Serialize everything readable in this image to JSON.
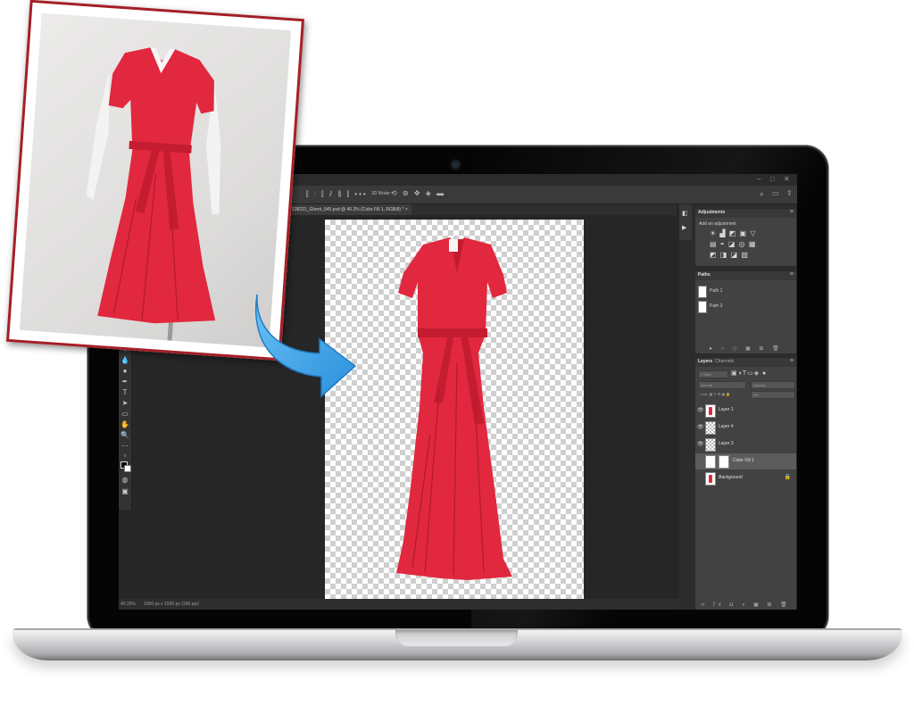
{
  "photoshop": {
    "document_tab": "138221_Ghent_545.psd @ 40.3% (Color Fill 1, RGB/8) *",
    "options_bar_label": "3D Mode:",
    "status_zoom": "40.33%",
    "status_doc": "1000 px x 1500 px (300 ppi)"
  },
  "panels": {
    "adjustments": {
      "title": "Adjustments",
      "hint": "Add an adjustment"
    },
    "paths": {
      "title": "Paths",
      "items": [
        {
          "name": "Path 1"
        },
        {
          "name": "Path 2"
        }
      ]
    },
    "layers": {
      "tab_layers": "Layers",
      "tab_channels": "Channels",
      "filter_kind": "Kind",
      "blend_mode": "Normal",
      "opacity_label": "Opacity:",
      "lock_label": "Lock:",
      "fill_label": "Fill:",
      "items": [
        {
          "name": "Layer 1",
          "thumb": "dress"
        },
        {
          "name": "Layer 4",
          "thumb": "checker"
        },
        {
          "name": "Layer 3",
          "thumb": "checker"
        },
        {
          "name": "Color Fill 1",
          "thumb": "fill",
          "selected": true
        },
        {
          "name": "Background",
          "thumb": "dress",
          "locked": true
        }
      ]
    }
  },
  "colors": {
    "dress_red": "#e1283e",
    "card_border": "#a51f26",
    "arrow_blue": "#3aa3e8",
    "panel_bg": "#424242",
    "workspace_bg": "#262626"
  },
  "icons": [
    "arrow-curved-icon",
    "eye-icon",
    "lock-icon",
    "search-icon",
    "move-tool-icon",
    "lasso-tool-icon",
    "brush-tool-icon",
    "type-tool-icon",
    "zoom-tool-icon"
  ]
}
